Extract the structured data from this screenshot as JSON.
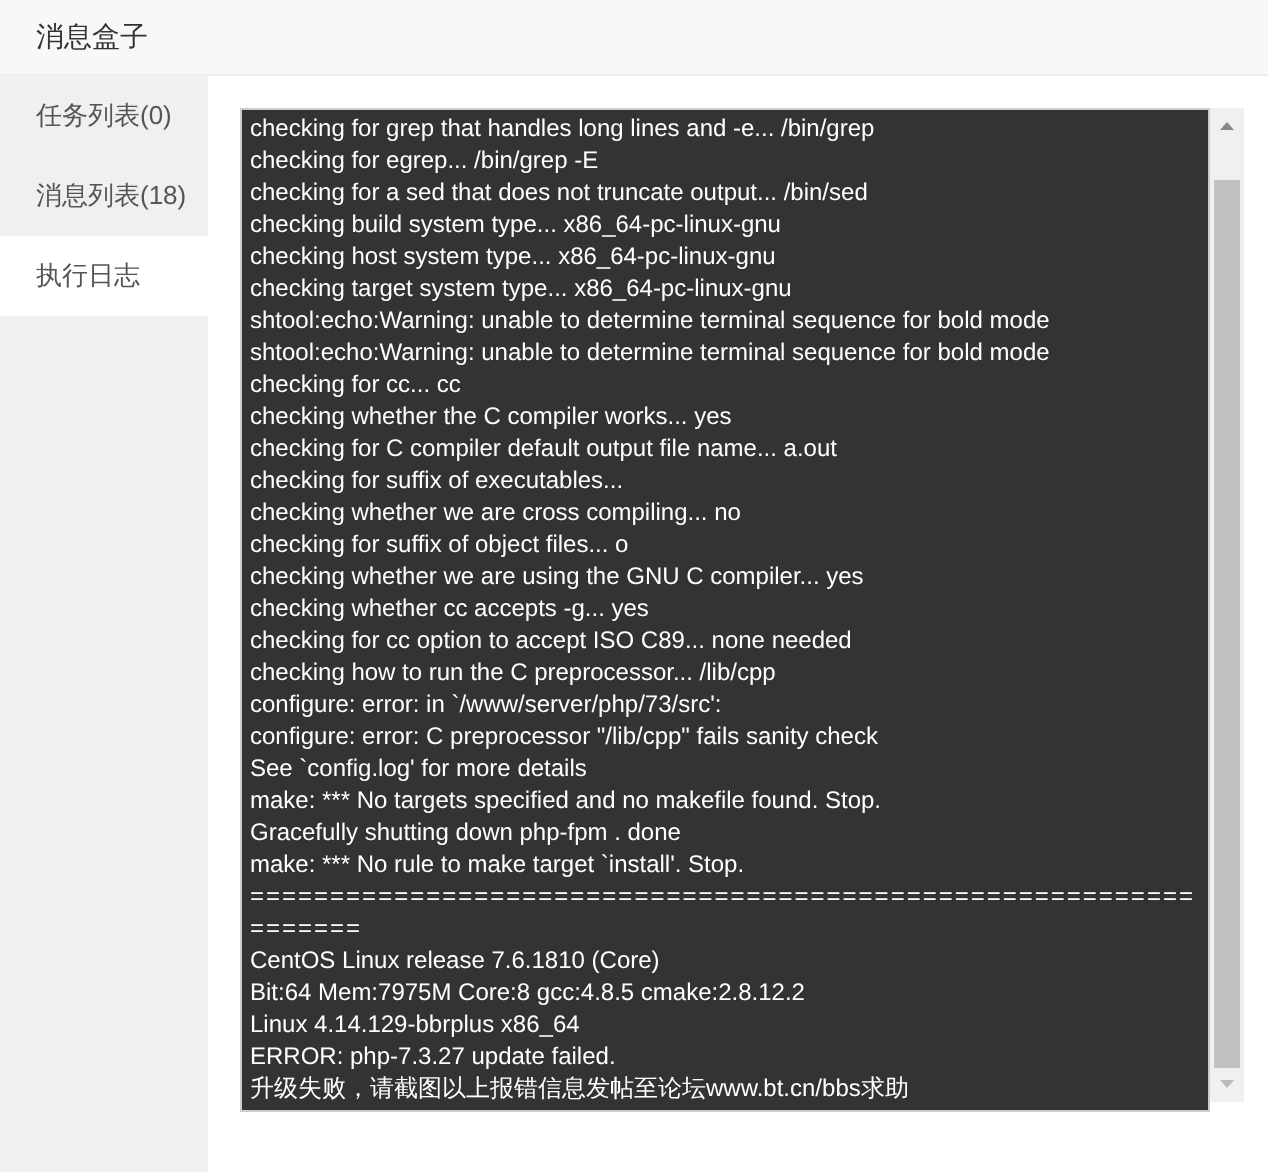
{
  "window": {
    "title": "消息盒子"
  },
  "sidebar": {
    "items": [
      {
        "label": "任务列表(0)",
        "selected": false
      },
      {
        "label": "消息列表(18)",
        "selected": false
      },
      {
        "label": "执行日志",
        "selected": true
      }
    ]
  },
  "log_lines": [
    "checking for grep that handles long lines and -e... /bin/grep",
    "checking for egrep... /bin/grep -E",
    "checking for a sed that does not truncate output... /bin/sed",
    "checking build system type... x86_64-pc-linux-gnu",
    "checking host system type... x86_64-pc-linux-gnu",
    "checking target system type... x86_64-pc-linux-gnu",
    "shtool:echo:Warning: unable to determine terminal sequence for bold mode",
    "shtool:echo:Warning: unable to determine terminal sequence for bold mode",
    "checking for cc... cc",
    "checking whether the C compiler works... yes",
    "checking for C compiler default output file name... a.out",
    "checking for suffix of executables...",
    "checking whether we are cross compiling... no",
    "checking for suffix of object files... o",
    "checking whether we are using the GNU C compiler... yes",
    "checking whether cc accepts -g... yes",
    "checking for cc option to accept ISO C89... none needed",
    "checking how to run the C preprocessor... /lib/cpp",
    "configure: error: in `/www/server/php/73/src':",
    "configure: error: C preprocessor \"/lib/cpp\" fails sanity check",
    "See `config.log' for more details",
    "make: *** No targets specified and no makefile found.  Stop.",
    "Gracefully shutting down php-fpm . done",
    "make: *** No rule to make target `install'.  Stop.",
    "==================================================================",
    "CentOS Linux release 7.6.1810 (Core)",
    "Bit:64 Mem:7975M Core:8 gcc:4.8.5 cmake:2.8.12.2",
    "Linux 4.14.129-bbrplus x86_64",
    "ERROR: php-7.3.27 update failed.",
    "升级失败，请截图以上报错信息发帖至论坛www.bt.cn/bbs求助"
  ]
}
